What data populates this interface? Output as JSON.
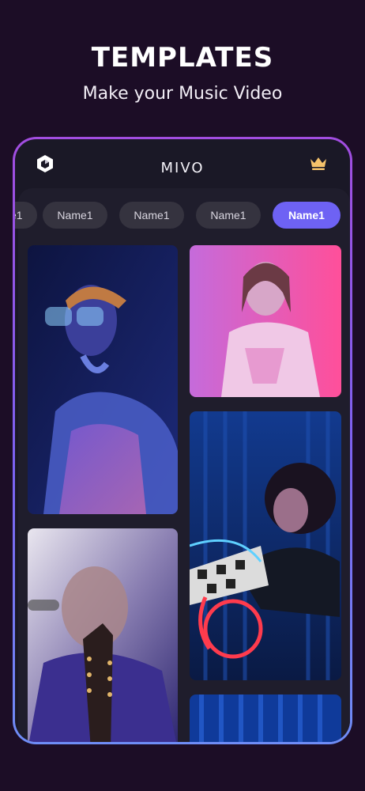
{
  "hero": {
    "title": "TEMPLATES",
    "subtitle": "Make your Music Video"
  },
  "app": {
    "title": "MIVO",
    "logo_icon": "hexagon-logo-icon",
    "premium_icon": "crown-icon"
  },
  "tabs": [
    {
      "label": "Name1",
      "active": false
    },
    {
      "label": "Name1",
      "active": false
    },
    {
      "label": "Name1",
      "active": false
    },
    {
      "label": "Name1",
      "active": true
    }
  ],
  "templates": [
    {
      "name": "neon-glasses-woman"
    },
    {
      "name": "pink-neon-woman"
    },
    {
      "name": "guitarist-stage"
    },
    {
      "name": "curly-hair-neon-woman"
    },
    {
      "name": "blue-curtain-stage"
    }
  ],
  "colors": {
    "background": "#1c0d26",
    "frame_gradient_top": "#a24de0",
    "frame_gradient_bottom": "#6f8df7",
    "accent": "#6e62f4",
    "crown": "#f5c26b"
  }
}
